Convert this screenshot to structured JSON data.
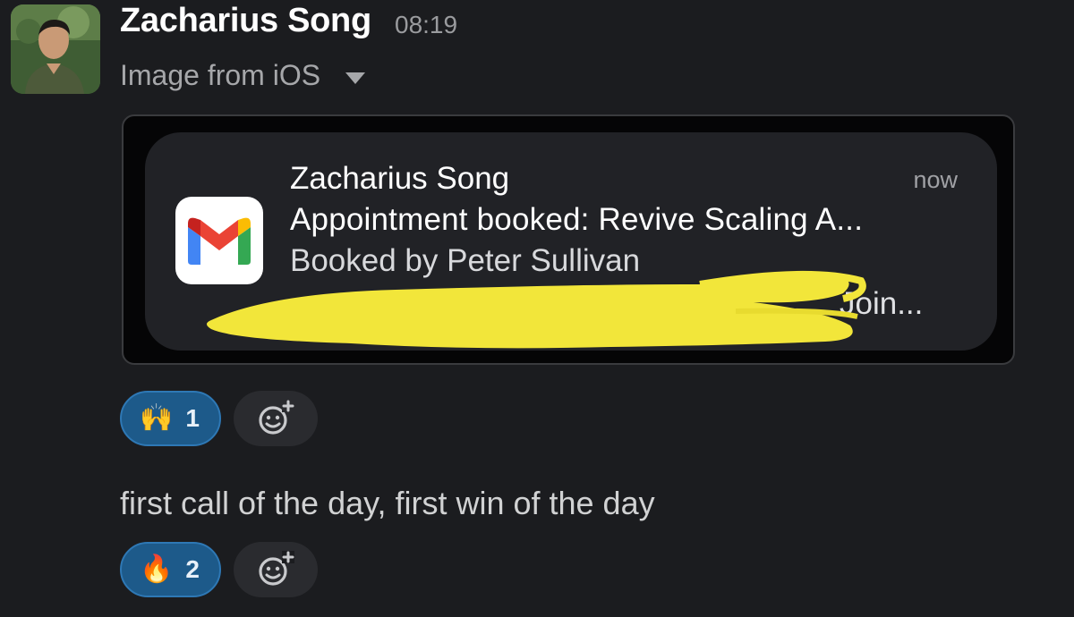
{
  "header": {
    "sender": "Zacharius Song",
    "time": "08:19",
    "file_label": "Image from iOS"
  },
  "notification": {
    "sender": "Zacharius Song",
    "time": "now",
    "subject": "Appointment booked: Revive Scaling A...",
    "booked_by": "Booked by Peter Sullivan",
    "join_text": "Join...",
    "app_icon": "gmail-icon",
    "redaction_color": "#f2e63a"
  },
  "reactions_image": [
    {
      "emoji": "🙌",
      "count": "1"
    }
  ],
  "message": {
    "text": "first call of the day, first win of the day"
  },
  "reactions_message": [
    {
      "emoji": "🔥",
      "count": "2"
    }
  ],
  "colors": {
    "background": "#1b1c1f",
    "reaction_bg": "#1d5a8a",
    "reaction_border": "#2e78b5"
  }
}
